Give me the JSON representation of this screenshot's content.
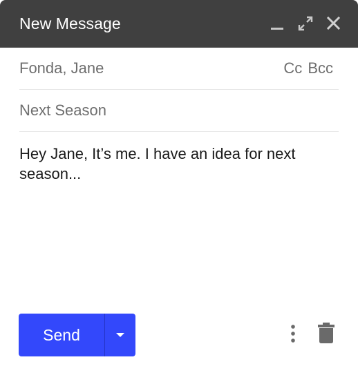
{
  "window": {
    "title": "New Message",
    "controls": {
      "minimize_icon": "minimize-icon",
      "expand_icon": "expand-icon",
      "close_icon": "close-icon"
    }
  },
  "fields": {
    "to_value": "Fonda, Jane",
    "cc_label": "Cc",
    "bcc_label": "Bcc",
    "subject_value": "Next Season"
  },
  "message": {
    "body": "Hey Jane, It’s me. I have an idea for next season..."
  },
  "footer": {
    "send_label": "Send",
    "send_dropdown_icon": "caret-down-icon",
    "more_icon": "more-vert-icon",
    "delete_icon": "trash-icon"
  },
  "colors": {
    "titlebar": "#404040",
    "send_button": "#3348fb",
    "muted_text": "#6e6e6e",
    "icon_gray": "#6a6a6a"
  }
}
